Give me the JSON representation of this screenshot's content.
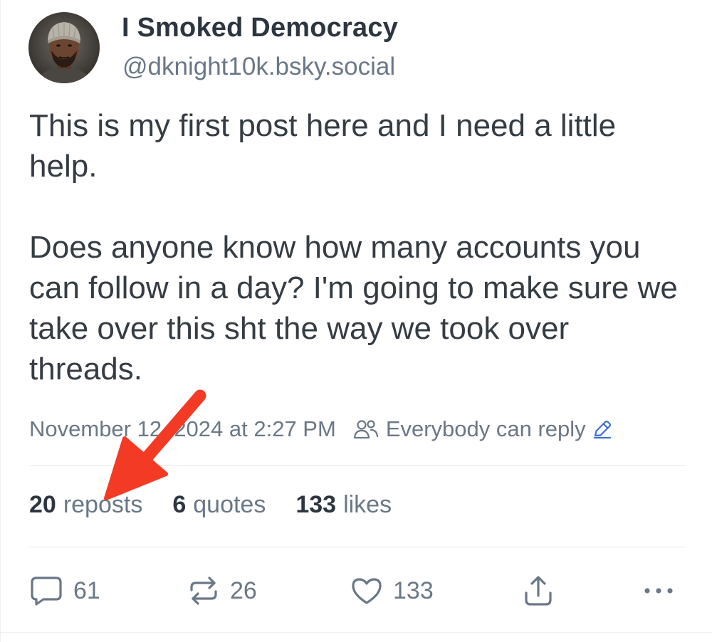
{
  "post": {
    "author": {
      "display_name": "I Smoked Democracy",
      "handle": "@dknight10k.bsky.social"
    },
    "text_paragraphs": [
      "This is my first post here and I need a little help.",
      "Does anyone know how many accounts you can follow in a day? I'm going to make sure we take over this sht the way we took over threads."
    ],
    "timestamp": "November 12, 2024 at 2:27 PM",
    "reply_setting": "Everybody can reply",
    "stats": {
      "reposts": {
        "count": "20",
        "label": "reposts"
      },
      "quotes": {
        "count": "6",
        "label": "quotes"
      },
      "likes": {
        "count": "133",
        "label": "likes"
      }
    },
    "actions": {
      "reply_count": "61",
      "repost_count": "26",
      "like_count": "133"
    }
  },
  "icons": {
    "reply": "speech-bubble-icon",
    "repost": "repost-arrows-icon",
    "like": "heart-icon",
    "share": "share-upload-icon",
    "more": "more-dots-icon",
    "reply_setting": "people-icon",
    "edit": "pencil-icon"
  },
  "colors": {
    "annotation_arrow": "#f23a25",
    "muted_text": "#6a7787",
    "body_text": "#353c43",
    "heading_text": "#2d3640",
    "edit_icon": "#3b6fd6"
  }
}
